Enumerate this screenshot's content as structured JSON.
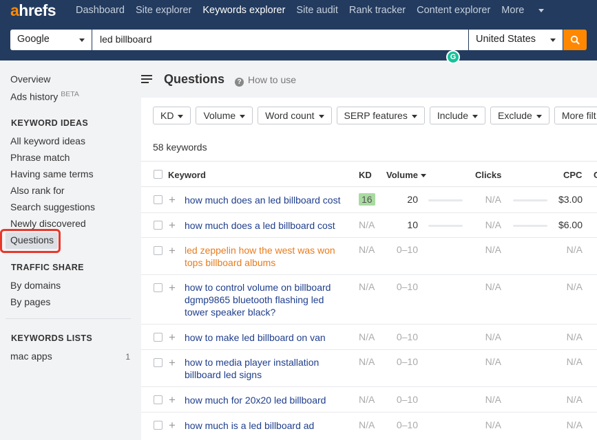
{
  "app": {
    "logo_a": "a",
    "logo_rest": "hrefs",
    "nav": [
      "Dashboard",
      "Site explorer",
      "Keywords explorer",
      "Site audit",
      "Rank tracker",
      "Content explorer",
      "More"
    ]
  },
  "search": {
    "engine": "Google",
    "query": "led billboard",
    "country": "United States"
  },
  "sidebar": {
    "overview": "Overview",
    "ads_history": "Ads history",
    "beta": "BETA",
    "keyword_ideas_head": "KEYWORD IDEAS",
    "keyword_ideas": [
      "All keyword ideas",
      "Phrase match",
      "Having same terms",
      "Also rank for",
      "Search suggestions",
      "Newly discovered",
      "Questions"
    ],
    "traffic_share_head": "TRAFFIC SHARE",
    "traffic_share": [
      "By domains",
      "By pages"
    ],
    "keywords_lists_head": "KEYWORDS LISTS",
    "list_name": "mac apps",
    "list_count": "1"
  },
  "main": {
    "title": "Questions",
    "how_to_use": "How to use",
    "filters": [
      "KD",
      "Volume",
      "Word count",
      "SERP features",
      "Include",
      "Exclude",
      "More filt"
    ],
    "keyword_count": "58 keywords",
    "columns": {
      "keyword": "Keyword",
      "kd": "KD",
      "volume": "Volume",
      "clicks": "Clicks",
      "cpc": "CPC",
      "cut": "C"
    },
    "rows": [
      {
        "keyword": "how much does an led billboard cost",
        "kd": "16",
        "volume": "20",
        "clicks": "N/A",
        "cpc": "$3.00"
      },
      {
        "keyword": "how much does a led billboard cost",
        "kd": "N/A",
        "volume": "10",
        "clicks": "N/A",
        "cpc": "$6.00"
      },
      {
        "keyword": "led zeppelin how the west was won tops billboard albums",
        "kd": "N/A",
        "volume": "0–10",
        "clicks": "N/A",
        "cpc": "N/A"
      },
      {
        "keyword": "how to control volume on billboard dgmp9865 bluetooth flashing led tower speaker black?",
        "kd": "N/A",
        "volume": "0–10",
        "clicks": "N/A",
        "cpc": "N/A"
      },
      {
        "keyword": "how to make led billboard on van",
        "kd": "N/A",
        "volume": "0–10",
        "clicks": "N/A",
        "cpc": "N/A"
      },
      {
        "keyword": "how to media player installation billboard led signs",
        "kd": "N/A",
        "volume": "0–10",
        "clicks": "N/A",
        "cpc": "N/A"
      },
      {
        "keyword": "how much for 20x20 led billboard",
        "kd": "N/A",
        "volume": "0–10",
        "clicks": "N/A",
        "cpc": "N/A"
      },
      {
        "keyword": "how much is a led billboard ad",
        "kd": "N/A",
        "volume": "0–10",
        "clicks": "N/A",
        "cpc": "N/A"
      }
    ]
  },
  "colors": {
    "accent": "#ff8800",
    "topbar": "#233b5e",
    "link": "#1f3e8c",
    "visited_link": "#e87b1c",
    "kd_badge": "#a9dba1",
    "highlight": "#e8372a"
  }
}
